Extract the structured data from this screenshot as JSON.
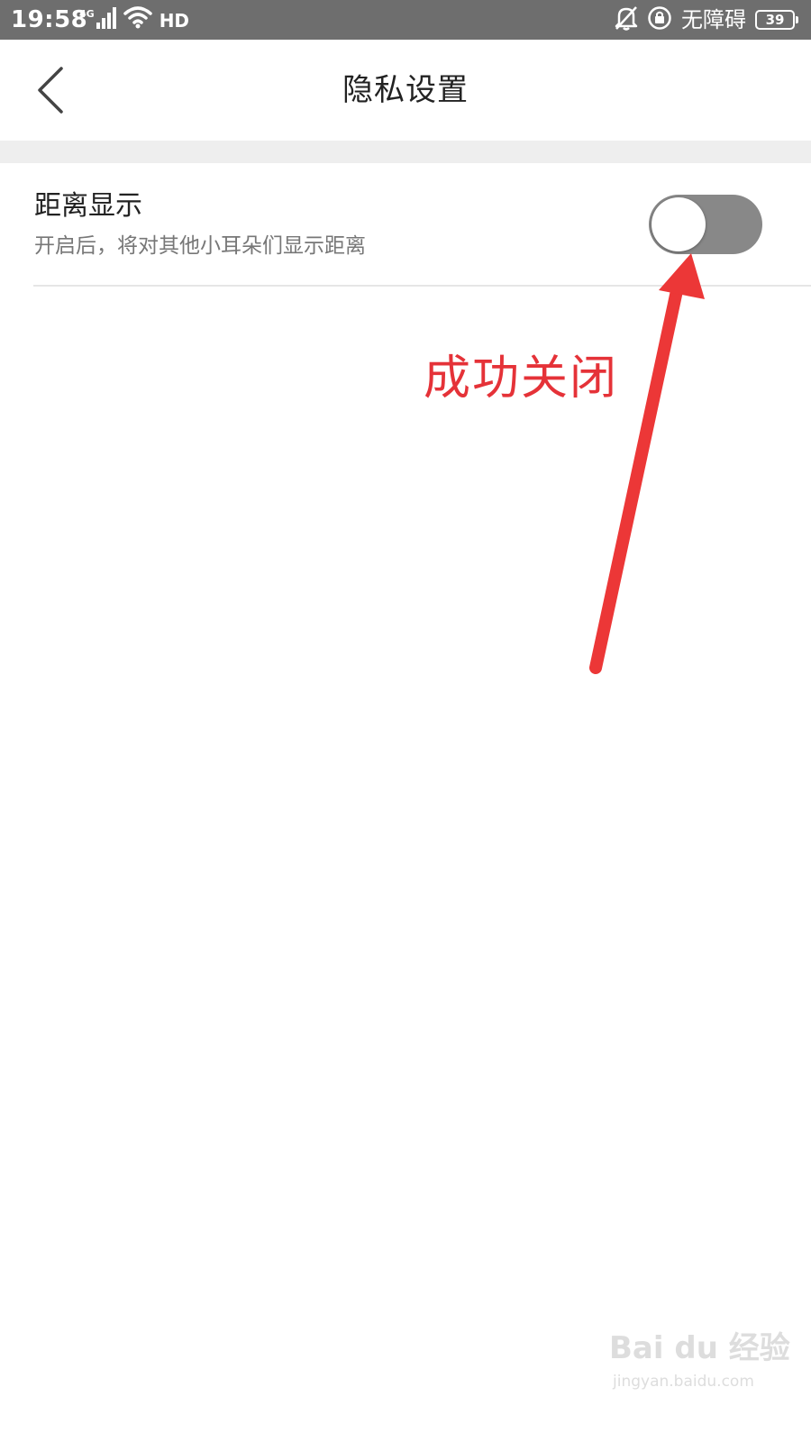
{
  "status_bar": {
    "time": "19:58",
    "network": "4G",
    "hd_label": "HD",
    "accessibility_label": "无障碍",
    "battery_level": "39",
    "icons": [
      "signal-icon",
      "wifi-icon",
      "hd-icon",
      "bell-muted-icon",
      "rotation-lock-icon",
      "battery-icon"
    ]
  },
  "header": {
    "title": "隐私设置",
    "back_icon": "chevron-left-icon"
  },
  "settings": {
    "distance_display": {
      "title": "距离显示",
      "description": "开启后，将对其他小耳朵们显示距离",
      "enabled": false
    }
  },
  "annotation": {
    "text": "成功关闭",
    "color": "#e53238"
  },
  "watermark": {
    "main": "Bai du 经验",
    "sub": "jingyan.baidu.com"
  },
  "colors": {
    "status_bar_bg": "#6e6e6e",
    "toggle_off": "#888888",
    "section_gap": "#eeeeee"
  }
}
